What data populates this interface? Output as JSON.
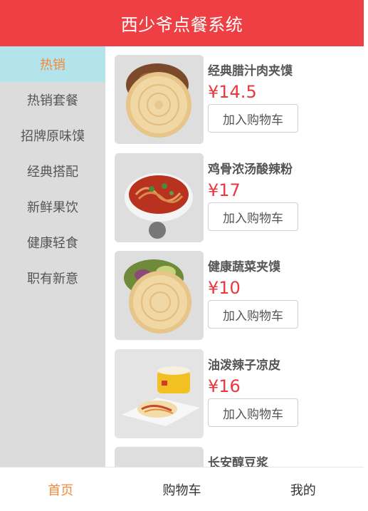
{
  "header": {
    "title": "西少爷点餐系统"
  },
  "sidebar": {
    "items": [
      {
        "label": "热销",
        "active": true
      },
      {
        "label": "热销套餐",
        "active": false
      },
      {
        "label": "招牌原味馍",
        "active": false
      },
      {
        "label": "经典搭配",
        "active": false
      },
      {
        "label": "新鲜果饮",
        "active": false
      },
      {
        "label": "健康轻食",
        "active": false
      },
      {
        "label": "职有新意",
        "active": false
      }
    ]
  },
  "products": [
    {
      "name": "经典腊汁肉夹馍",
      "price": "¥14.5",
      "button": "加入购物车"
    },
    {
      "name": "鸡骨浓汤酸辣粉",
      "price": "¥17",
      "button": "加入购物车"
    },
    {
      "name": "健康蔬菜夹馍",
      "price": "¥10",
      "button": "加入购物车"
    },
    {
      "name": "油泼辣子凉皮",
      "price": "¥16",
      "button": "加入购物车"
    },
    {
      "name": "长安醇豆浆"
    }
  ],
  "tabbar": {
    "items": [
      {
        "label": "首页",
        "active": true
      },
      {
        "label": "购物车",
        "active": false
      },
      {
        "label": "我的",
        "active": false
      }
    ]
  },
  "colors": {
    "brand": "#ee3f44",
    "accent": "#f08a3c",
    "price": "#e8383d",
    "sidebar_bg": "#dcdcdc",
    "sidebar_active_bg": "#b3e4ec"
  }
}
